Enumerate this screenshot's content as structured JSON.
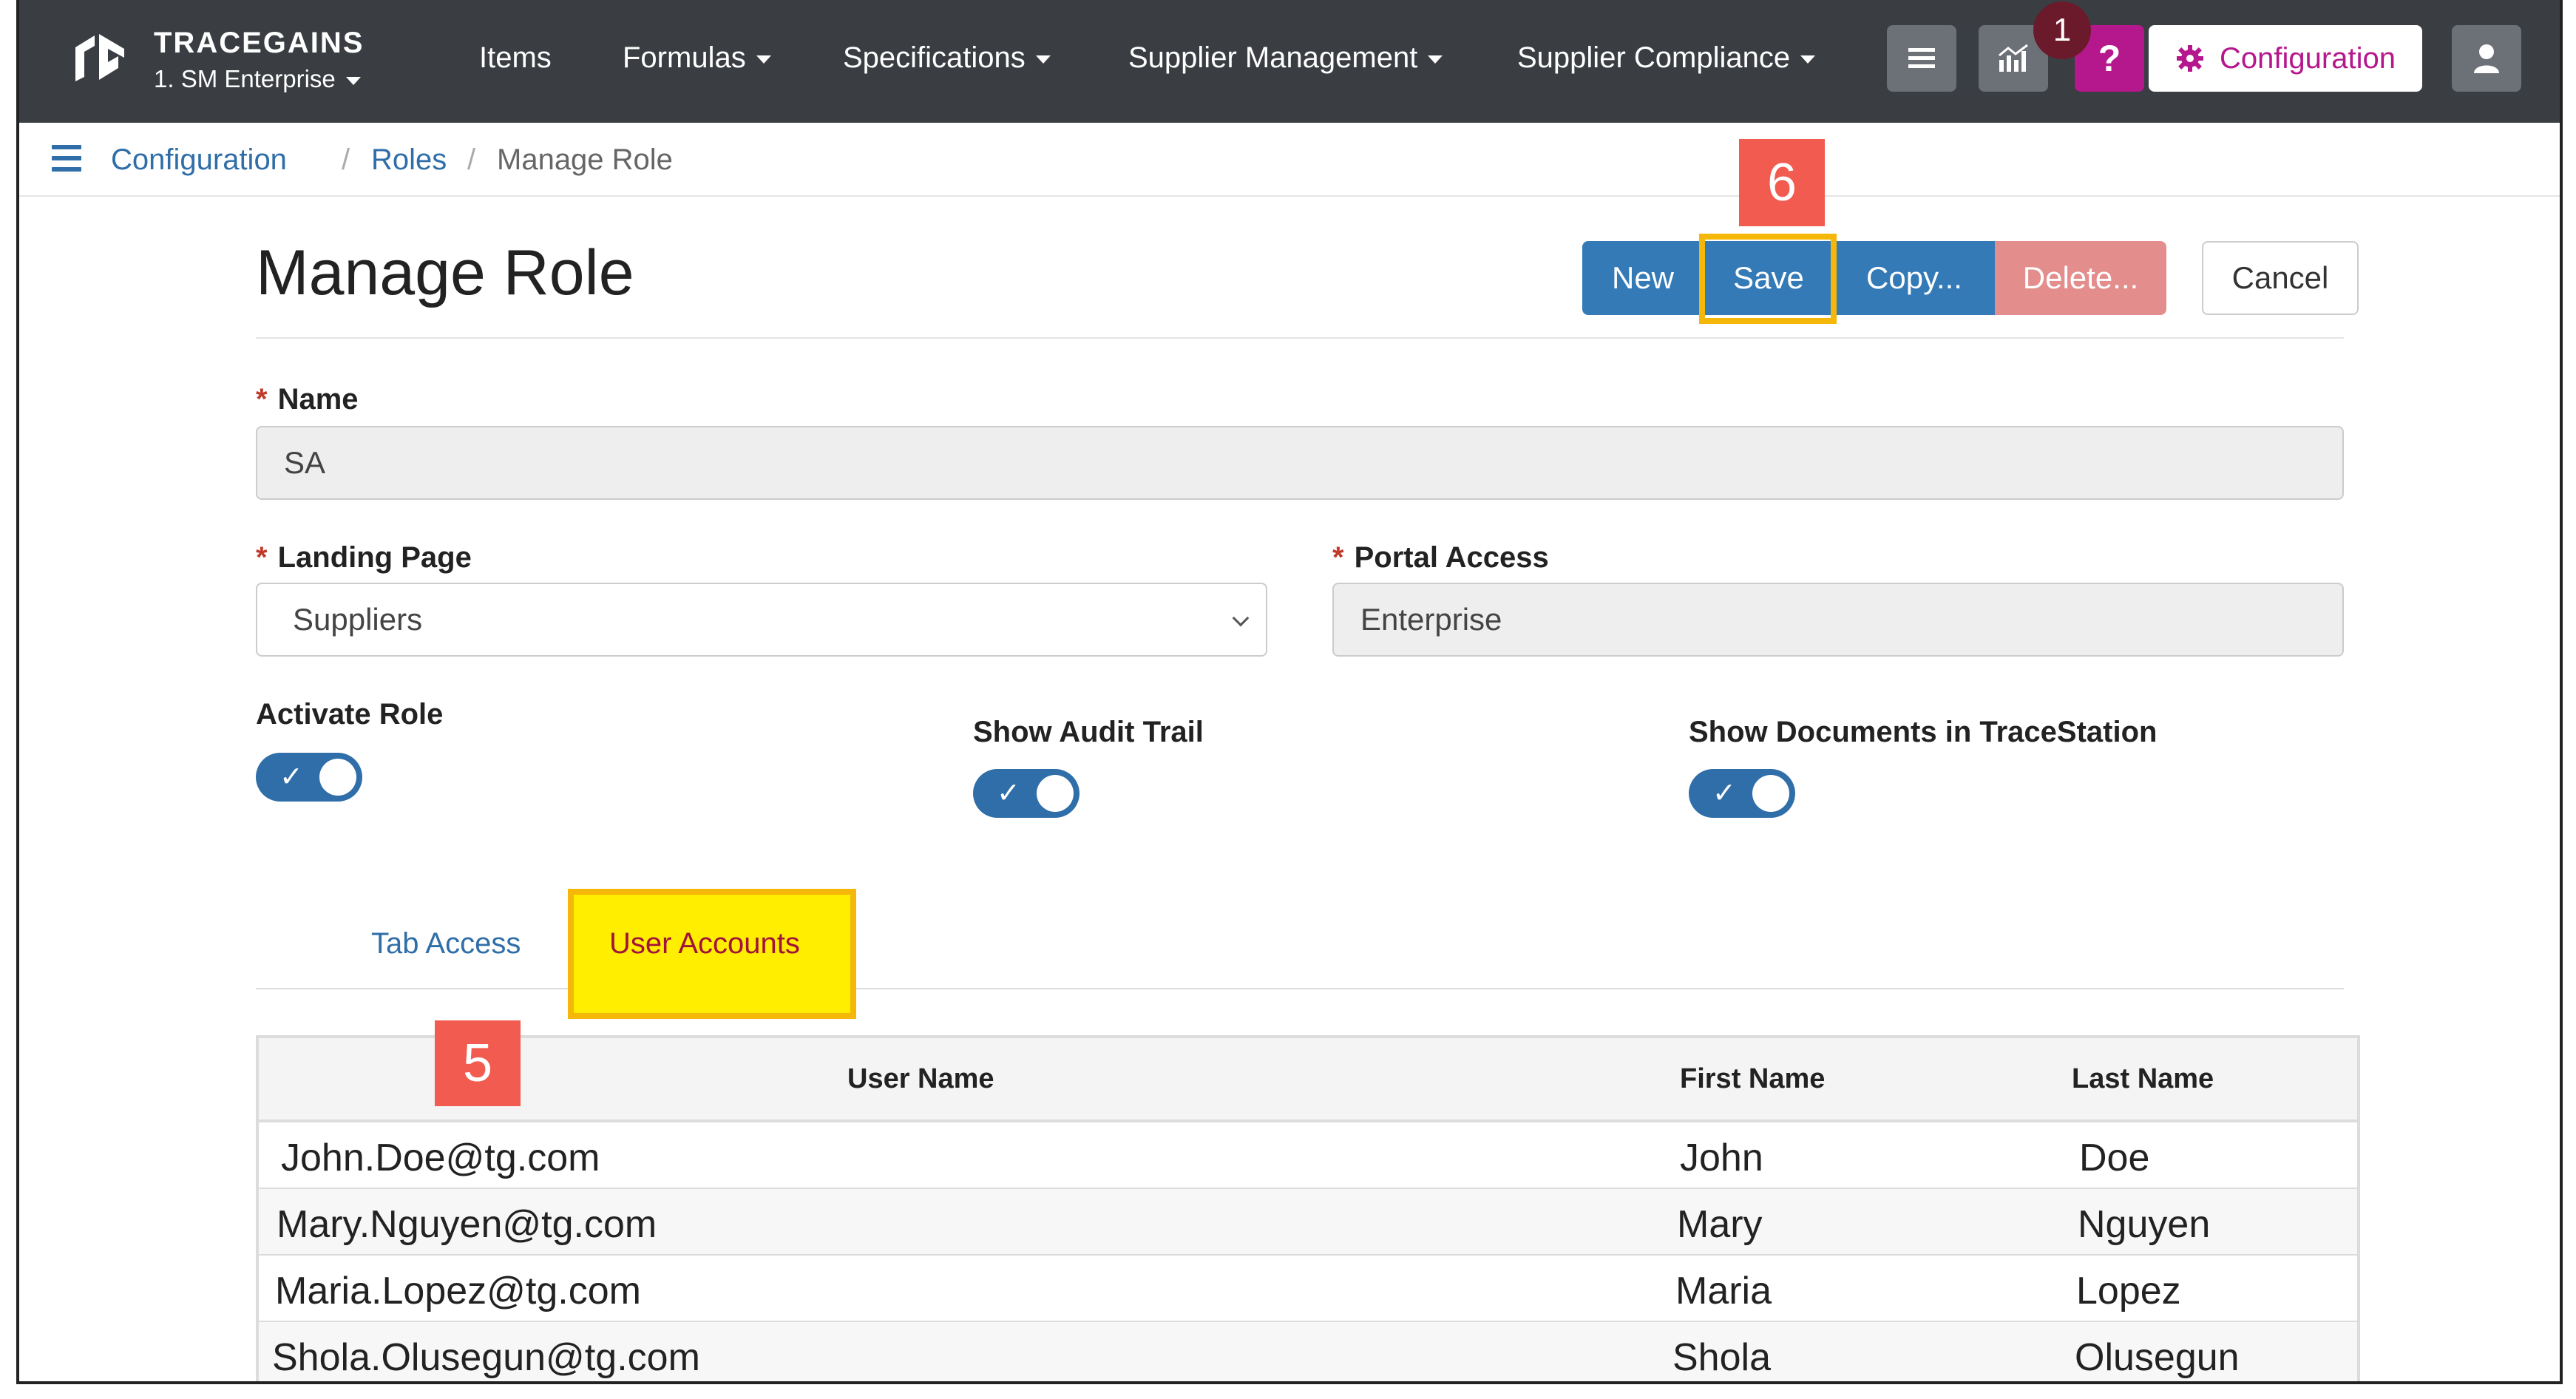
{
  "brand": {
    "name": "TRACEGAINS",
    "subtitle": "1. SM Enterprise"
  },
  "nav": {
    "items": [
      {
        "label": "Items",
        "dropdown": false
      },
      {
        "label": "Formulas",
        "dropdown": true
      },
      {
        "label": "Specifications",
        "dropdown": true
      },
      {
        "label": "Supplier Management",
        "dropdown": true
      },
      {
        "label": "Supplier Compliance",
        "dropdown": true
      }
    ],
    "help_badge": "1",
    "help_label": "?",
    "config_label": "Configuration",
    "colors": {
      "navbar": "#3a3d42",
      "accent": "#b5178d"
    }
  },
  "breadcrumb": {
    "items": [
      "Configuration",
      "Roles"
    ],
    "current": "Manage Role",
    "separator": "/"
  },
  "page": {
    "title": "Manage Role",
    "actions": {
      "new": "New",
      "save": "Save",
      "copy": "Copy...",
      "delete": "Delete...",
      "cancel": "Cancel"
    }
  },
  "callouts": {
    "save_step": "6",
    "table_step": "5"
  },
  "form": {
    "required_mark": "*",
    "name_label": "Name",
    "name_value": "SA",
    "landing_label": "Landing Page",
    "landing_value": "Suppliers",
    "portal_label": "Portal Access",
    "portal_value": "Enterprise",
    "toggles": [
      {
        "label": "Activate Role",
        "on": true
      },
      {
        "label": "Show Audit Trail",
        "on": true
      },
      {
        "label": "Show Documents in TraceStation",
        "on": true
      }
    ],
    "check_glyph": "✓"
  },
  "tabs": {
    "tab_access": "Tab Access",
    "user_accounts": "User Accounts"
  },
  "table": {
    "headers": [
      "User Name",
      "First Name",
      "Last Name"
    ],
    "rows": [
      [
        "John.Doe@tg.com",
        "John",
        "Doe"
      ],
      [
        "Mary.Nguyen@tg.com",
        "Mary",
        "Nguyen"
      ],
      [
        "Maria.Lopez@tg.com",
        "Maria",
        "Lopez"
      ],
      [
        "Shola.Olusegun@tg.com",
        "Shola",
        "Olusegun"
      ]
    ]
  }
}
